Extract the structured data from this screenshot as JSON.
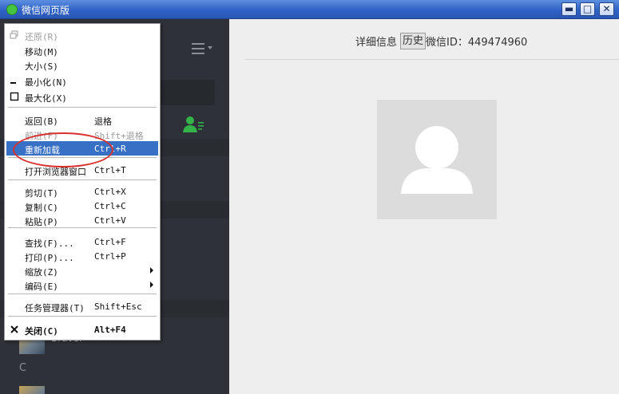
{
  "window": {
    "title": "微信网页版",
    "buttons": {
      "minimize": "▬",
      "maximize": "□",
      "close": "✕"
    }
  },
  "sidebar": {
    "section_letter": "C",
    "contact_name": "Braver"
  },
  "detail": {
    "label": "详细信息",
    "history_button": "历史",
    "wechat_id": "微信ID：449474960"
  },
  "context_menu": {
    "items": [
      {
        "label": "还原(R)",
        "shortcut": "",
        "disabled": true,
        "icon": "restore-icon"
      },
      {
        "label": "移动(M)",
        "shortcut": ""
      },
      {
        "label": "大小(S)",
        "shortcut": ""
      },
      {
        "label": "最小化(N)",
        "shortcut": "",
        "icon": "minimize-icon"
      },
      {
        "label": "最大化(X)",
        "shortcut": "",
        "icon": "maximize-icon"
      },
      {
        "label": "返回(B)",
        "shortcut": "退格"
      },
      {
        "label": "前进(F)",
        "shortcut": "Shift+退格",
        "disabled": true
      },
      {
        "label": "重新加载",
        "shortcut": "Ctrl+R",
        "highlighted": true
      },
      {
        "label": "打开浏览器窗口",
        "shortcut": "Ctrl+T"
      },
      {
        "label": "剪切(T)",
        "shortcut": "Ctrl+X"
      },
      {
        "label": "复制(C)",
        "shortcut": "Ctrl+C"
      },
      {
        "label": "粘贴(P)",
        "shortcut": "Ctrl+V"
      },
      {
        "label": "查找(F)...",
        "shortcut": "Ctrl+F"
      },
      {
        "label": "打印(P)...",
        "shortcut": "Ctrl+P"
      },
      {
        "label": "缩放(Z)",
        "shortcut": "",
        "submenu": true
      },
      {
        "label": "编码(E)",
        "shortcut": "",
        "submenu": true
      },
      {
        "label": "任务管理器(T)",
        "shortcut": "Shift+Esc"
      },
      {
        "label": "关闭(C)",
        "shortcut": "Alt+F4",
        "bold": true,
        "icon": "close-icon"
      }
    ]
  },
  "colors": {
    "titlebar": "#2f62c6",
    "sidebar": "#2e3238",
    "menu_highlight": "#3770c5",
    "annotation": "#d8312e",
    "contact_icon": "#33b34a"
  }
}
